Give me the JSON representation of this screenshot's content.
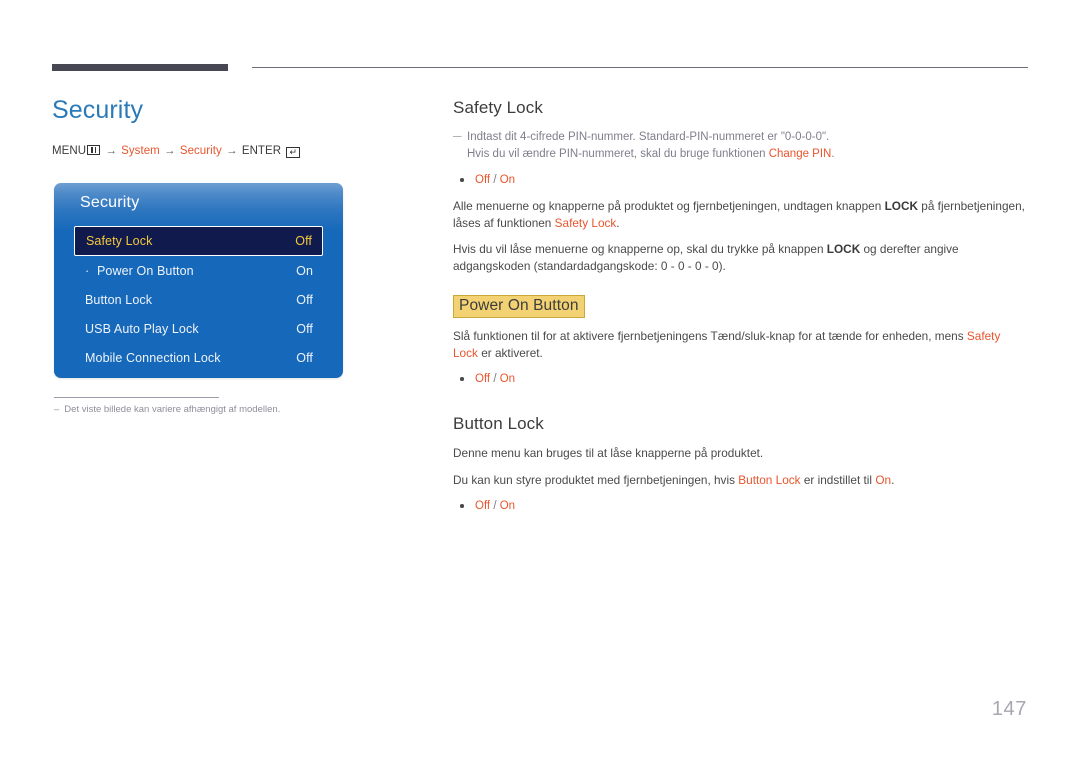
{
  "page": {
    "number": "147"
  },
  "left": {
    "title": "Security",
    "menu_path": {
      "menu_label": "MENU",
      "menu_icon": "menu-bars-icon",
      "arrow": "→",
      "step1": "System",
      "step2": "Security",
      "enter_label": "ENTER",
      "enter_icon": "enter-key-icon",
      "enter_glyph": "↵"
    },
    "osd": {
      "title": "Security",
      "rows": [
        {
          "label": "Safety Lock",
          "value": "Off",
          "selected": true,
          "sub": false
        },
        {
          "label": "Power On Button",
          "value": "On",
          "selected": false,
          "sub": true,
          "dot": "·"
        },
        {
          "label": "Button Lock",
          "value": "Off",
          "selected": false,
          "sub": false
        },
        {
          "label": "USB Auto Play Lock",
          "value": "Off",
          "selected": false,
          "sub": false
        },
        {
          "label": "Mobile Connection Lock",
          "value": "Off",
          "selected": false,
          "sub": false
        }
      ]
    },
    "footnote": {
      "dash": "–",
      "text": "Det viste billede kan variere afhængigt af modellen."
    }
  },
  "right": {
    "safety_lock": {
      "heading": "Safety Lock",
      "note_dash": "─",
      "note_line1": "Indtast dit 4-cifrede PIN-nummer. Standard-PIN-nummeret er \"0-0-0-0\".",
      "note_line2_pre": "Hvis du vil ændre PIN-nummeret, skal du bruge funktionen ",
      "note_line2_accent": "Change PIN",
      "note_line2_post": ".",
      "option_off": "Off",
      "option_sep": " / ",
      "option_on": "On",
      "para1_pre": "Alle menuerne og knapperne på produktet og fjernbetjeningen, undtagen knappen ",
      "para1_strong": "LOCK",
      "para1_mid": " på fjernbetjeningen, låses af funktionen ",
      "para1_accent": "Safety Lock",
      "para1_post": ".",
      "para2_pre": "Hvis du vil låse menuerne og knapperne op, skal du trykke på knappen ",
      "para2_strong": "LOCK",
      "para2_post": " og derefter angive adgangskoden (standardadgangskode: 0 - 0 - 0 - 0)."
    },
    "power_on_button": {
      "heading": "Power On Button",
      "para1_pre": "Slå funktionen til for at aktivere fjernbetjeningens Tænd/sluk-knap for at tænde for enheden, mens ",
      "para1_accent": "Safety Lock",
      "para1_post": " er aktiveret.",
      "option_off": "Off",
      "option_sep": " / ",
      "option_on": "On"
    },
    "button_lock": {
      "heading": "Button Lock",
      "para1": "Denne menu kan bruges til at låse knapperne på produktet.",
      "para2_pre": "Du kan kun styre produktet med fjernbetjeningen, hvis ",
      "para2_accent1": "Button Lock",
      "para2_mid": " er indstillet til ",
      "para2_accent2": "On",
      "para2_post": ".",
      "option_off": "Off",
      "option_sep": " / ",
      "option_on": "On"
    }
  },
  "colors": {
    "title_blue": "#2b7ab8",
    "accent_orange": "#e8552d",
    "osd_blue": "#1668ba",
    "osd_selected_bg": "#101a4d",
    "osd_selected_text": "#f4c83c",
    "highlight_yellow": "#f2d272",
    "rule_dark": "#474754",
    "page_number_gray": "#a7a7b2"
  }
}
